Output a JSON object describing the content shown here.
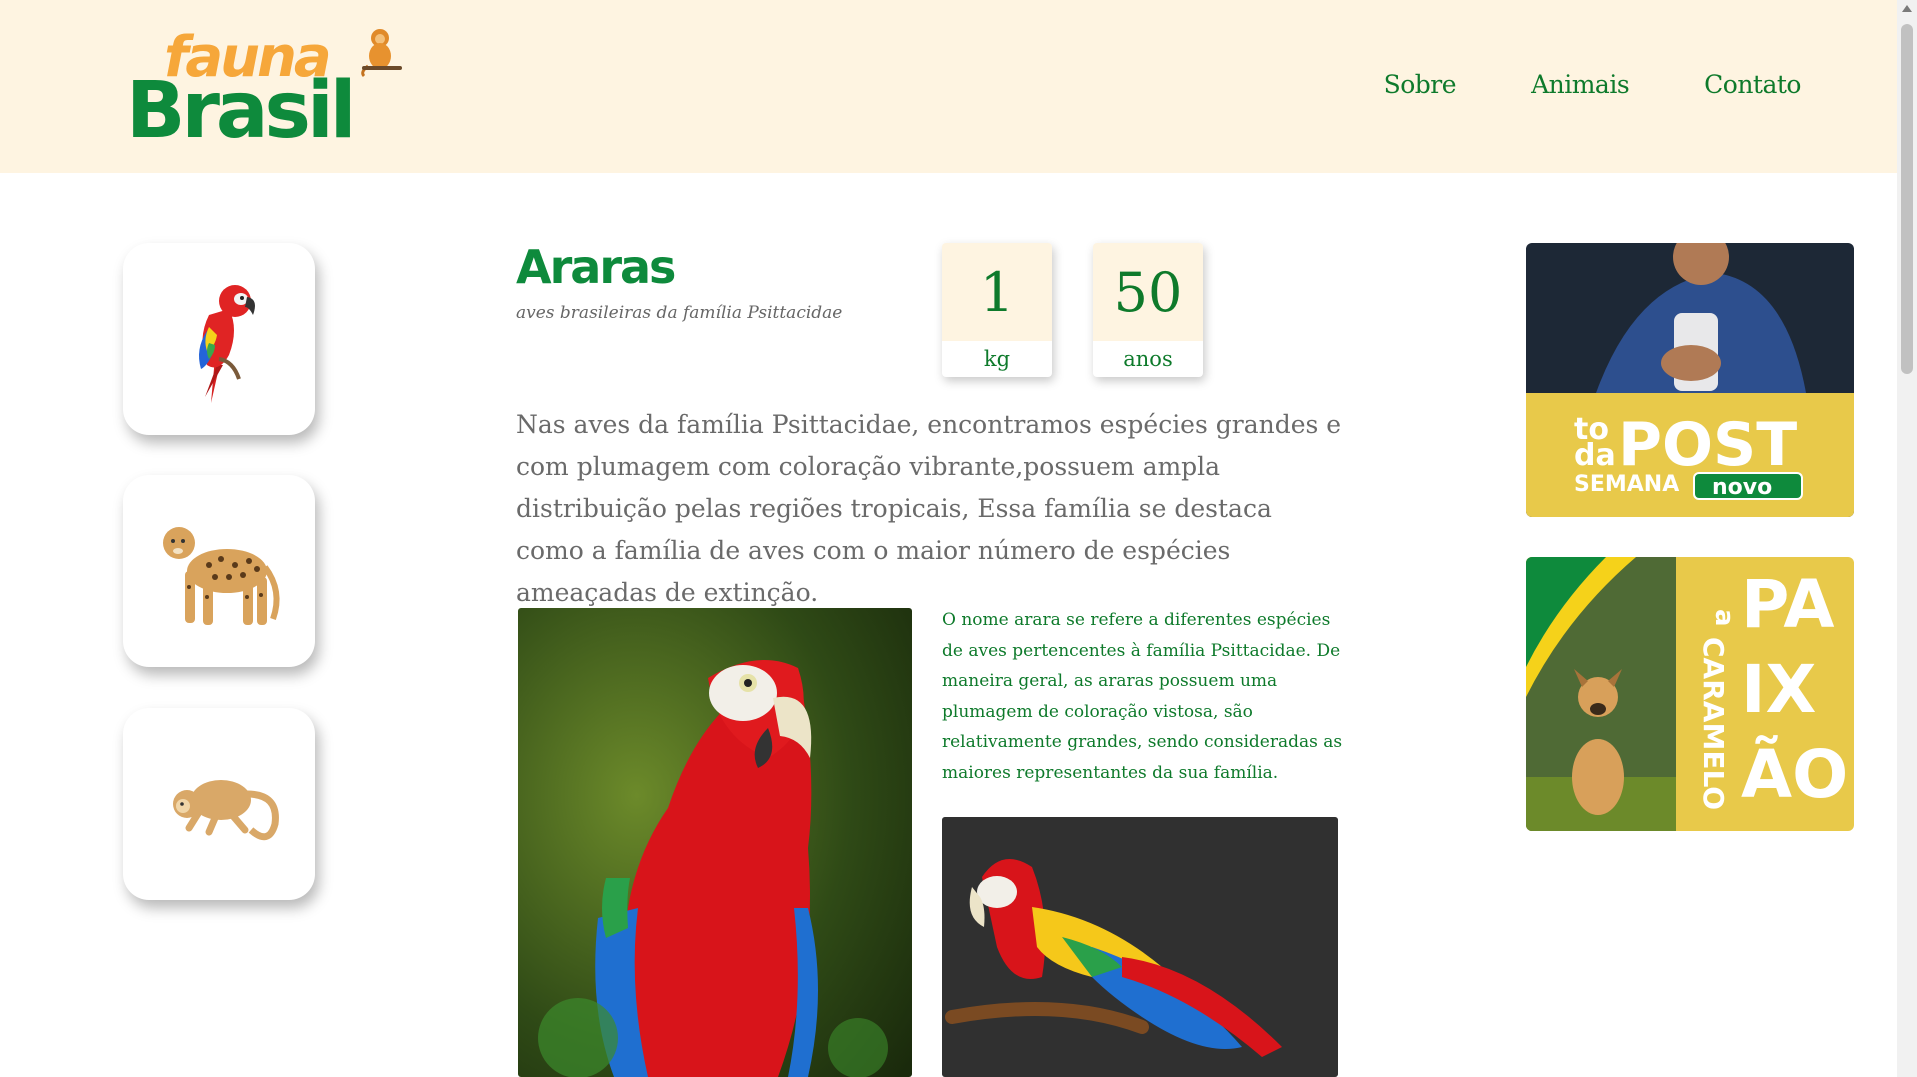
{
  "header": {
    "logo_top": "fauna",
    "logo_bottom": "Brasil",
    "nav": [
      "Sobre",
      "Animais",
      "Contato"
    ]
  },
  "sidebar": {
    "cards": [
      {
        "icon": "macaw-icon"
      },
      {
        "icon": "jaguar-icon"
      },
      {
        "icon": "monkey-icon"
      }
    ]
  },
  "main": {
    "title": "Araras",
    "subtitle": "aves brasileiras da família Psittacidae",
    "stats": [
      {
        "value": "1",
        "unit": "kg"
      },
      {
        "value": "50",
        "unit": "anos"
      }
    ],
    "lead": "Nas aves da família Psittacidae, encontramos espécies grandes e com plumagem com coloração vibrante,possuem ampla distribuição pelas regiões tropicais, Essa família se destaca como a família de aves com o maior número de espécies ameaçadas de extinção.",
    "description": "O nome arara se refere a diferentes espécies de aves pertencentes à família Psittacidae. De maneira geral, as araras possuem uma plumagem de coloração vistosa, são relativamente grandes, sendo consideradas as maiores representantes da sua família."
  },
  "ads": [
    {
      "line1": "to",
      "line2": "da",
      "big": "POST",
      "small": "SEMANA",
      "tag": "novo"
    },
    {
      "small": "a",
      "vertical": "CARAMELO",
      "big1": "PA",
      "big2": "IX",
      "big3": "ÃO"
    }
  ],
  "colors": {
    "brand_green": "#0e8a3c",
    "brand_orange": "#f6a73a",
    "header_bg": "#fef4e1",
    "ad_yellow": "#e8c94a"
  }
}
